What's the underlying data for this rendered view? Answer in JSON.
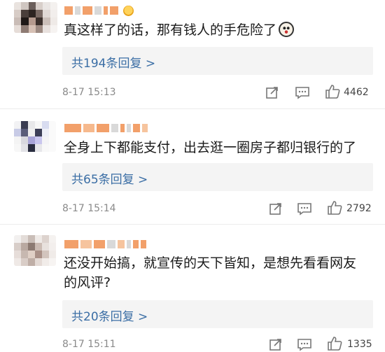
{
  "comments": [
    {
      "text": "真这样了的话，那有钱人的手危险了",
      "reply_label": "共194条回复 >",
      "time": "8-17 15:13",
      "likes": "4462",
      "has_emoji": true,
      "has_badge": true
    },
    {
      "text": "全身上下都能支付，出去逛一圈房子都归银行的了",
      "reply_label": "共65条回复 >",
      "time": "8-17 15:14",
      "likes": "2792",
      "has_emoji": false,
      "has_badge": false
    },
    {
      "text": "还没开始搞，就宣传的天下皆知，是想先看看网友的风评?",
      "reply_label": "共20条回复 >",
      "time": "8-17 15:11",
      "likes": "1335",
      "has_emoji": false,
      "has_badge": false
    }
  ],
  "icons": [
    "share-icon",
    "comment-icon",
    "like-icon",
    "emoji-icon",
    "badge-icon"
  ]
}
